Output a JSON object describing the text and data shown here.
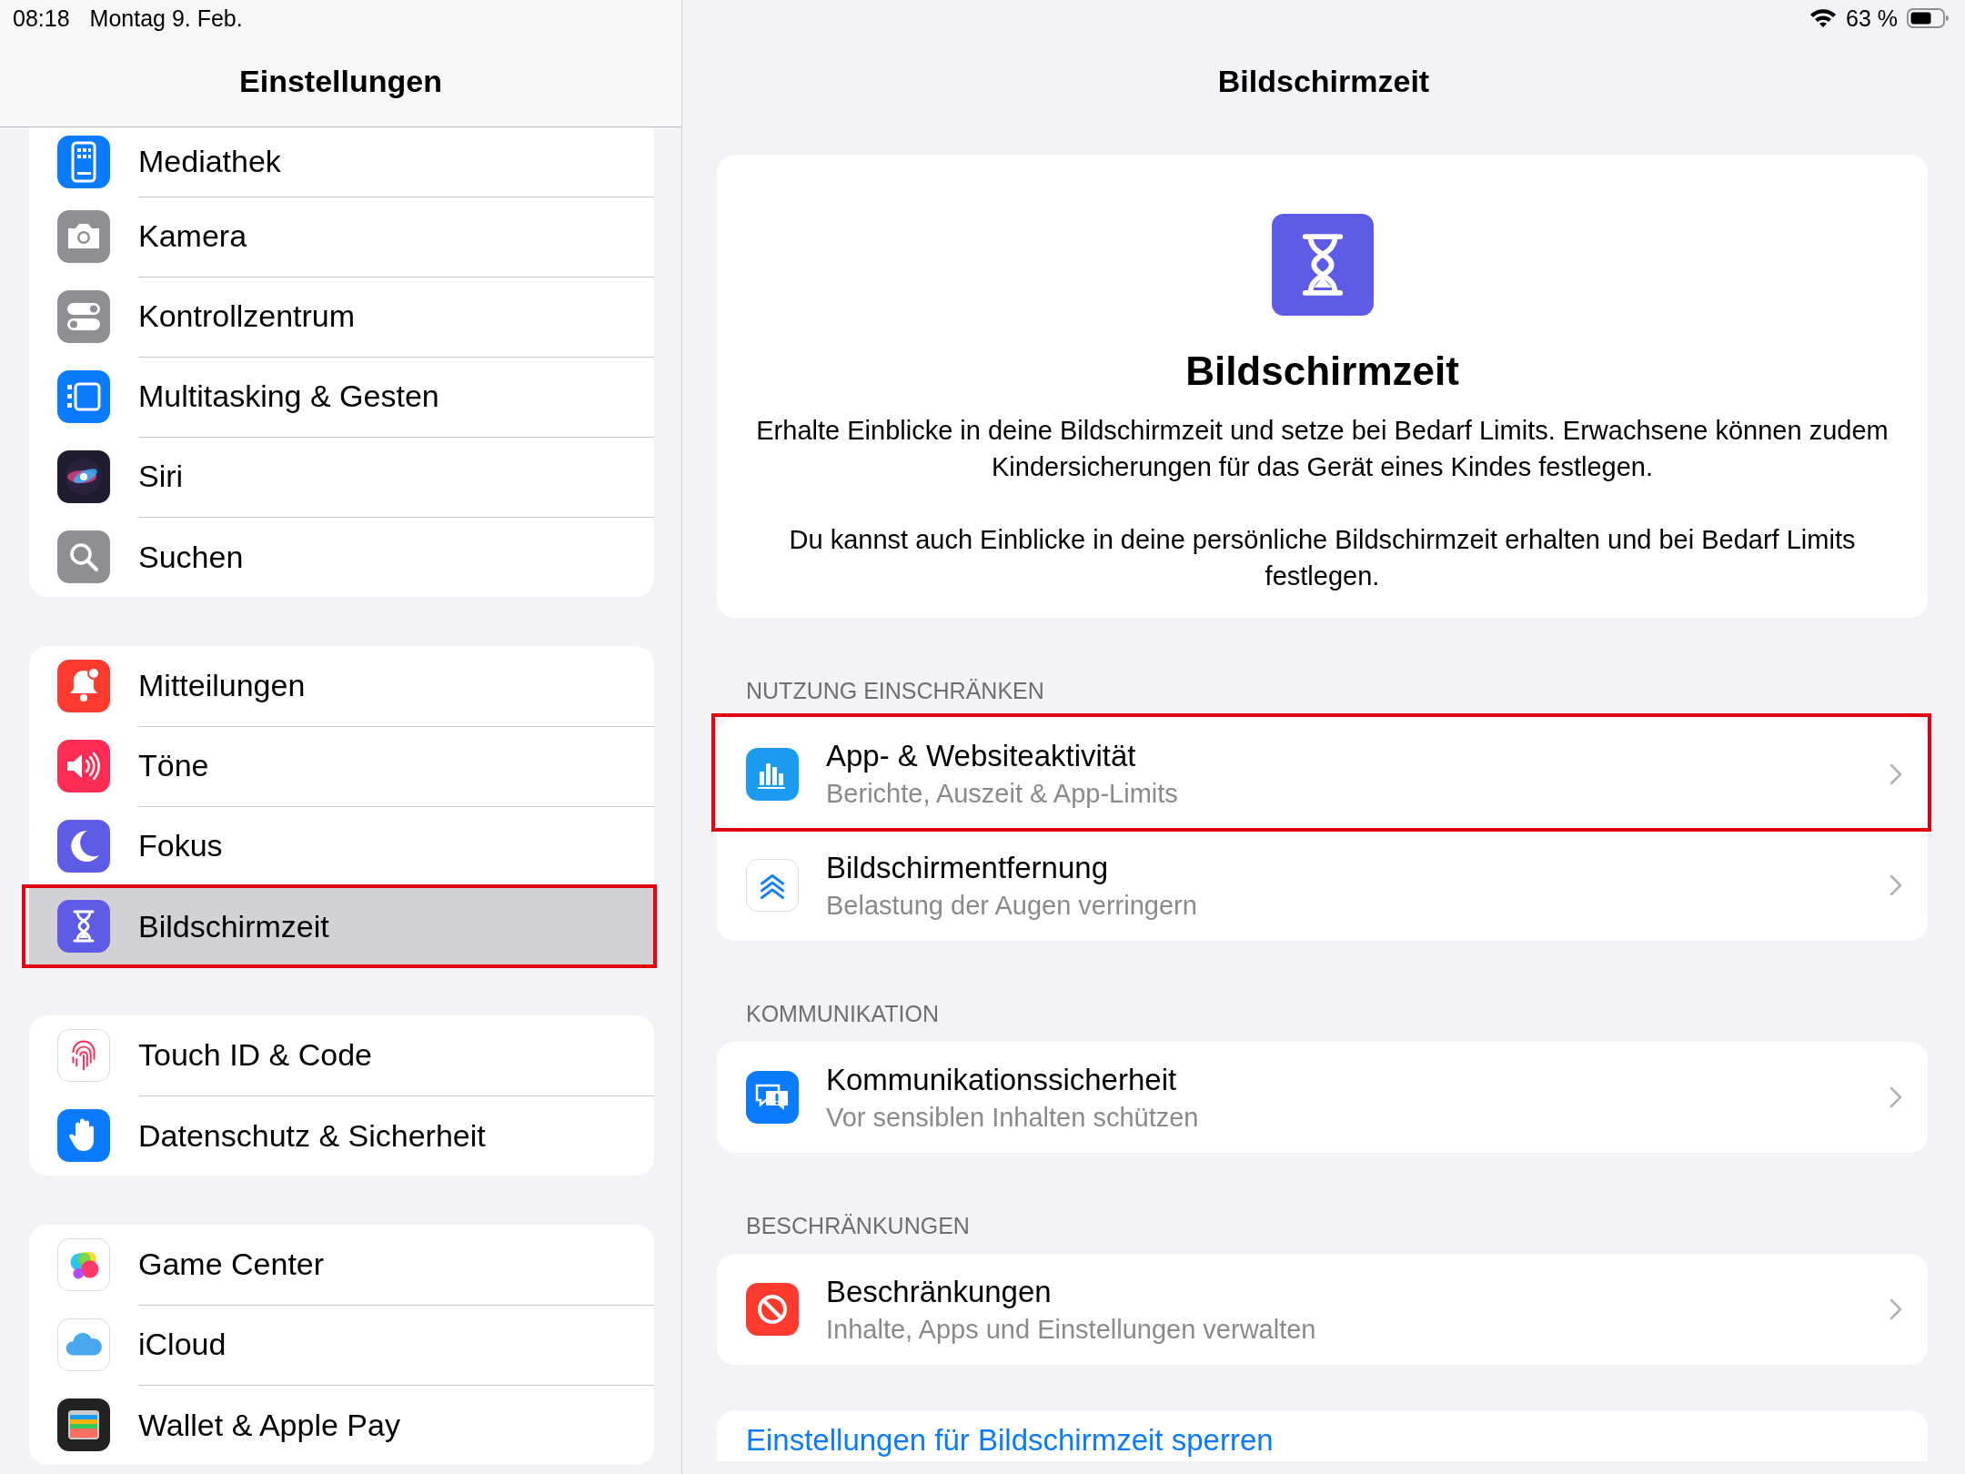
{
  "status_bar": {
    "time": "08:18",
    "date": "Montag 9. Feb.",
    "battery": "63 %"
  },
  "sidebar": {
    "title": "Einstellungen",
    "groups": [
      {
        "items": [
          {
            "label": "Mediathek",
            "kind": "homescreen",
            "selected": false,
            "highlighted": false
          },
          {
            "label": "Kamera",
            "kind": "camera",
            "selected": false,
            "highlighted": false
          },
          {
            "label": "Kontrollzentrum",
            "kind": "controls",
            "selected": false,
            "highlighted": false
          },
          {
            "label": "Multitasking & Gesten",
            "kind": "multitasking",
            "selected": false,
            "highlighted": false
          },
          {
            "label": "Siri",
            "kind": "siri",
            "selected": false,
            "highlighted": false
          },
          {
            "label": "Suchen",
            "kind": "search",
            "selected": false,
            "highlighted": false
          }
        ]
      },
      {
        "items": [
          {
            "label": "Mitteilungen",
            "kind": "notifications",
            "selected": false,
            "highlighted": false
          },
          {
            "label": "Töne",
            "kind": "sounds",
            "selected": false,
            "highlighted": false
          },
          {
            "label": "Fokus",
            "kind": "focus",
            "selected": false,
            "highlighted": false
          },
          {
            "label": "Bildschirmzeit",
            "kind": "screentime",
            "selected": true,
            "highlighted": true
          }
        ]
      },
      {
        "items": [
          {
            "label": "Touch ID & Code",
            "kind": "fingerprint",
            "selected": false,
            "highlighted": false
          },
          {
            "label": "Datenschutz & Sicherheit",
            "kind": "privacy",
            "selected": false,
            "highlighted": false
          }
        ]
      },
      {
        "items": [
          {
            "label": "Game Center",
            "kind": "gamecenter",
            "selected": false,
            "highlighted": false
          },
          {
            "label": "iCloud",
            "kind": "icloud",
            "selected": false,
            "highlighted": false
          },
          {
            "label": "Wallet & Apple Pay",
            "kind": "wallet",
            "selected": false,
            "highlighted": false
          }
        ]
      }
    ]
  },
  "detail": {
    "title": "Bildschirmzeit",
    "hero": {
      "title": "Bildschirmzeit",
      "paragraphs": [
        "Erhalte Einblicke in deine Bildschirmzeit und setze bei Bedarf Limits. Erwachsene können zudem Kindersicherungen für das Gerät eines Kindes festlegen.",
        "Du kannst auch Einblicke in deine persönliche Bildschirmzeit erhalten und bei Bedarf Limits festlegen."
      ]
    },
    "sections": [
      {
        "header": "NUTZUNG EINSCHRÄNKEN",
        "rows": [
          {
            "title": "App- & Websiteaktivität",
            "subtitle": "Berichte, Auszeit & App-Limits",
            "kind": "activity",
            "highlighted": true
          },
          {
            "title": "Bildschirmentfernung",
            "subtitle": "Belastung der Augen verringern",
            "kind": "distance",
            "highlighted": false
          }
        ]
      },
      {
        "header": "KOMMUNIKATION",
        "rows": [
          {
            "title": "Kommunikationssicherheit",
            "subtitle": "Vor sensiblen Inhalten schützen",
            "kind": "communication",
            "highlighted": false
          }
        ]
      },
      {
        "header": "BESCHRÄNKUNGEN",
        "rows": [
          {
            "title": "Beschränkungen",
            "subtitle": "Inhalte, Apps und Einstellungen verwalten",
            "kind": "restrictions",
            "highlighted": false
          }
        ]
      }
    ],
    "lock_link": "Einstellungen für Bildschirmzeit sperren"
  }
}
